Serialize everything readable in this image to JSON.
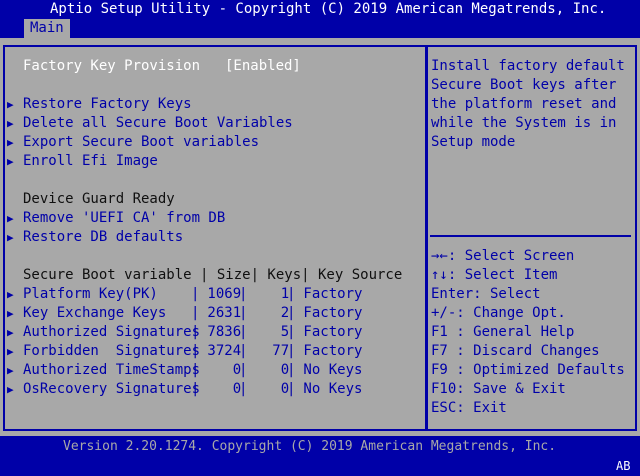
{
  "header": {
    "title": "Aptio Setup Utility - Copyright (C) 2019 American Megatrends, Inc.",
    "tab": "Main"
  },
  "settings": {
    "factory_key_provision_label": "Factory Key Provision",
    "factory_key_provision_value": "[Enabled]",
    "actions": [
      "Restore Factory Keys",
      "Delete all Secure Boot Variables",
      "Export Secure Boot variables",
      "Enroll Efi Image"
    ],
    "device_guard_label": "Device Guard Ready",
    "device_guard_actions": [
      "Remove 'UEFI CA' from DB",
      "Restore DB defaults"
    ]
  },
  "table": {
    "header": "Secure Boot variable | Size| Keys| Key Source",
    "rows": [
      {
        "name": "Platform Key(PK)    ",
        "size": " 1069",
        "keys": "    1",
        "source": " Factory"
      },
      {
        "name": "Key Exchange Keys   ",
        "size": " 2631",
        "keys": "    2",
        "source": " Factory"
      },
      {
        "name": "Authorized Signatures",
        "size": " 7836",
        "keys": "    5",
        "source": " Factory"
      },
      {
        "name": "Forbidden  Signatures",
        "size": " 3724",
        "keys": "   77",
        "source": " Factory"
      },
      {
        "name": "Authorized TimeStamps",
        "size": "    0",
        "keys": "    0",
        "source": " No Keys"
      },
      {
        "name": "OsRecovery Signatures",
        "size": "    0",
        "keys": "    0",
        "source": " No Keys"
      }
    ]
  },
  "help": {
    "lines": [
      "Install factory default",
      "Secure Boot keys after",
      "the platform reset and",
      "while the System is in",
      "Setup mode"
    ]
  },
  "keys": [
    "→←: Select Screen",
    "↑↓: Select Item",
    "Enter: Select",
    "+/-: Change Opt.",
    "F1 : General Help",
    "F7 : Discard Changes",
    "F9 : Optimized Defaults",
    "F10: Save & Exit",
    "ESC: Exit"
  ],
  "footer": {
    "version": "Version 2.20.1274. Copyright (C) 2019 American Megatrends, Inc.",
    "corner": "AB"
  },
  "colors": {
    "background": "#0000a8",
    "panel": "#a8a8a8",
    "text_blue": "#0000a8",
    "text_white": "#ffffff"
  }
}
